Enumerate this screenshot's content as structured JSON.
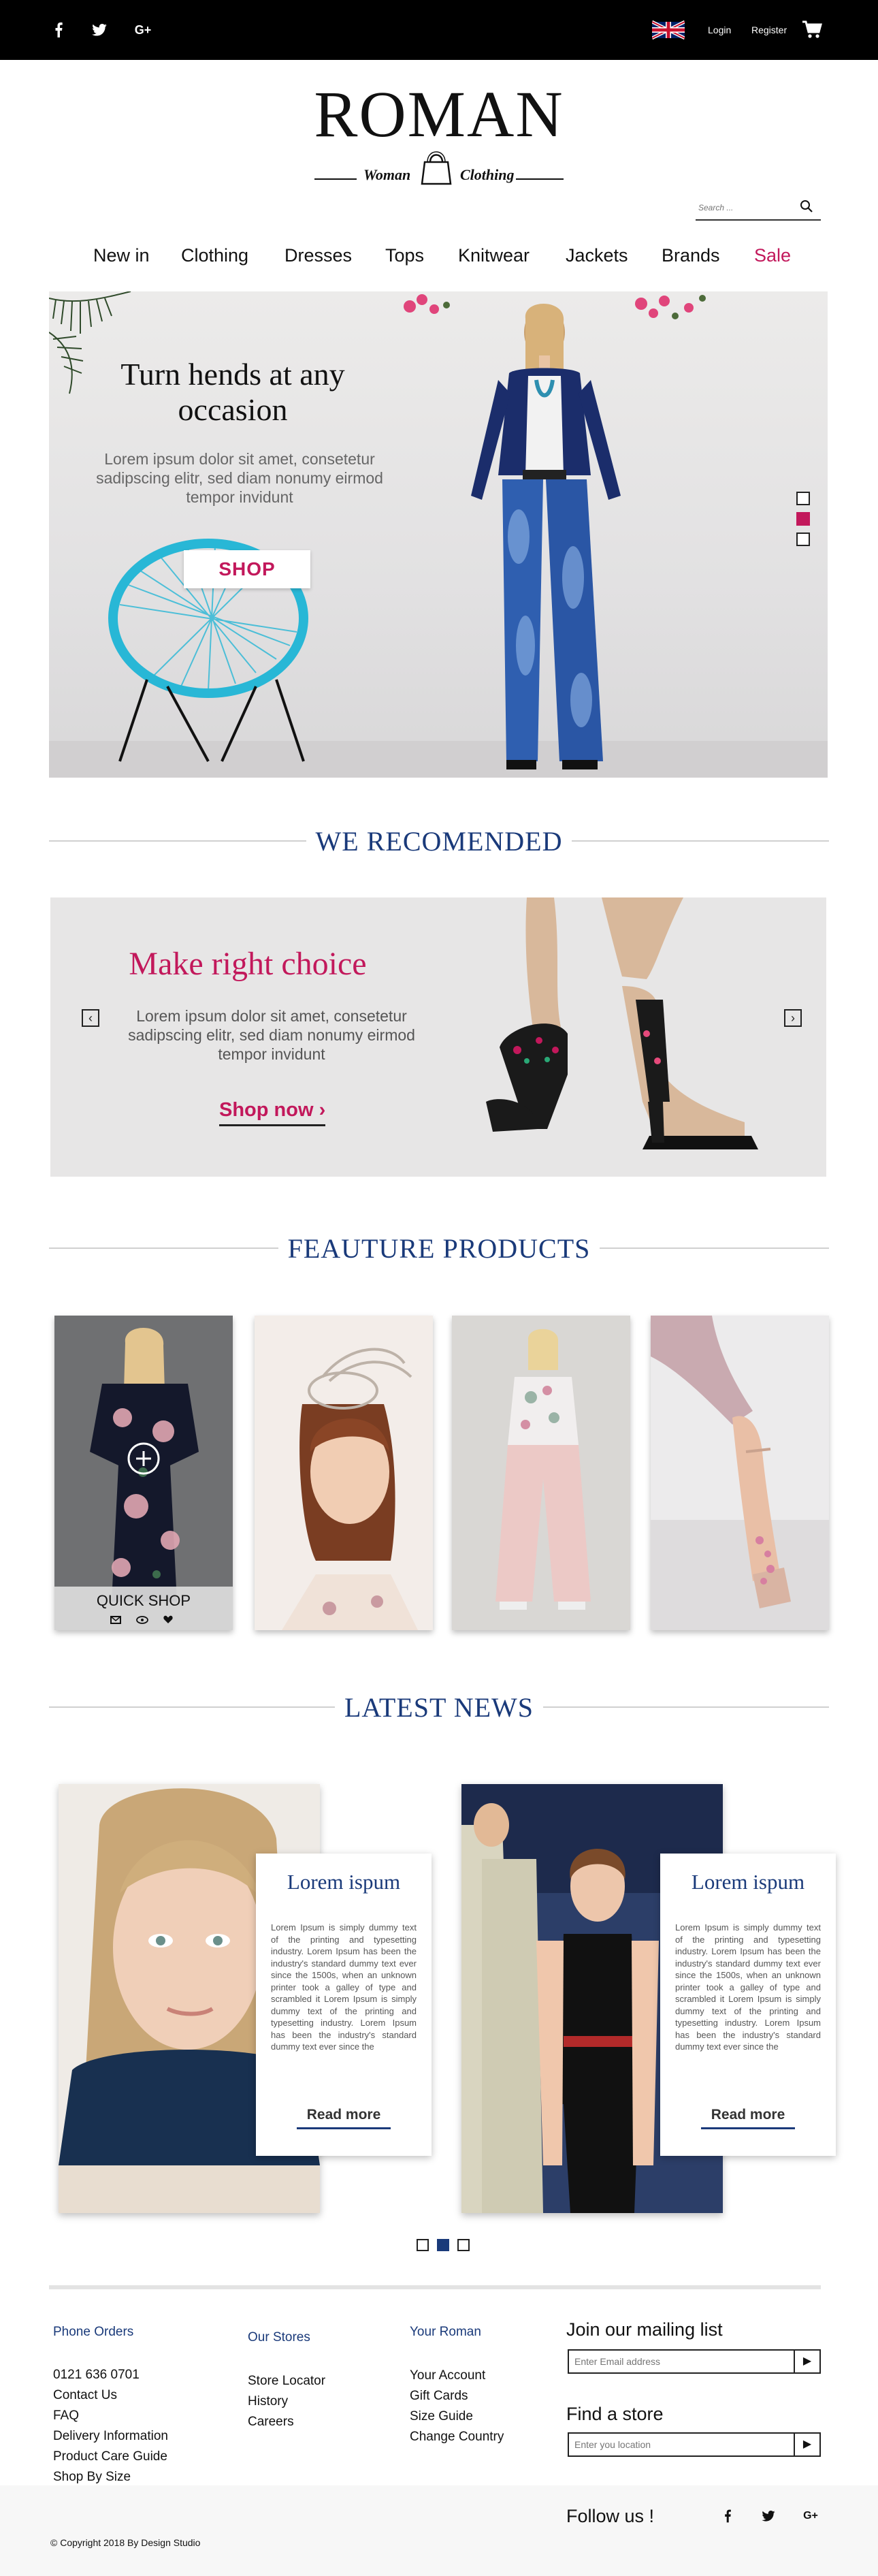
{
  "topbar": {
    "social": [
      {
        "name": "facebook",
        "glyph": "f"
      },
      {
        "name": "twitter",
        "glyph": "t"
      },
      {
        "name": "google-plus",
        "glyph": "G+"
      }
    ],
    "login": "Login",
    "register": "Register"
  },
  "logo": {
    "title": "ROMAN",
    "sub_left": "Woman",
    "sub_right": "Clothing"
  },
  "search": {
    "placeholder": "Search ..."
  },
  "nav": {
    "items": [
      "New in",
      "Clothing",
      "Dresses",
      "Tops",
      "Knitwear",
      "Jackets",
      "Brands",
      "Sale"
    ]
  },
  "hero": {
    "title": "Turn hends at any occasion",
    "description": "Lorem ipsum dolor sit amet, consetetur sadipscing elitr, sed diam nonumy eirmod tempor invidunt",
    "button": "SHOP",
    "slides": 3,
    "active_slide": 2
  },
  "recommended": {
    "heading": "WE RECOMENDED",
    "title": "Make right choice",
    "description": "Lorem ipsum dolor sit amet, consetetur sadipscing elitr, sed diam nonumy eirmod tempor invidunt",
    "link": "Shop now",
    "link_arrow": "›",
    "prev": "‹",
    "next": "›"
  },
  "featured": {
    "heading": "FEAUTURE PRODUCTS",
    "quick_shop": "QUICK SHOP"
  },
  "news": {
    "heading": "LATEST NEWS",
    "items": [
      {
        "title": "Lorem ispum",
        "body": "Lorem Ipsum is simply dummy text of the printing and typesetting industry. Lorem Ipsum has been the industry's standard dummy text ever since the 1500s, when an unknown printer took a galley of type and scrambled it Lorem Ipsum is simply dummy text of the printing and typesetting industry. Lorem Ipsum has been the industry's standard dummy text ever since the",
        "read_more": "Read more"
      },
      {
        "title": "Lorem ispum",
        "body": "Lorem Ipsum is simply dummy text of the printing and typesetting industry. Lorem Ipsum has been the industry's standard dummy text ever since the 1500s, when an unknown printer took a galley of type and scrambled it Lorem Ipsum is simply dummy text of the printing and typesetting industry. Lorem Ipsum has been the industry's standard dummy text ever since the",
        "read_more": "Read more"
      }
    ],
    "pages": 3,
    "active_page": 2
  },
  "footer": {
    "col1": {
      "heading": "Phone Orders",
      "links": [
        "0121 636 0701",
        "Contact Us",
        "FAQ",
        "Delivery Information",
        "Product Care Guide",
        "Shop By Size"
      ]
    },
    "col2": {
      "heading": "Our Stores",
      "links": [
        "Store Locator",
        "History",
        "Careers"
      ]
    },
    "col3": {
      "heading": "Your Roman",
      "links": [
        "Your Account",
        "Gift Cards",
        "Size Guide",
        "Change Country"
      ]
    },
    "mailing": {
      "heading": "Join our mailing list",
      "placeholder": "Enter Email address",
      "button": "▶"
    },
    "store": {
      "heading": "Find a store",
      "placeholder": "Enter you location",
      "button": "▶"
    },
    "follow": "Follow us !",
    "copyright_symbol": "©",
    "copyright": "Copyright 2018 By Design Studio"
  },
  "colors": {
    "accent": "#c2185b",
    "navy": "#1a3a7a",
    "topbar": "#000000"
  }
}
